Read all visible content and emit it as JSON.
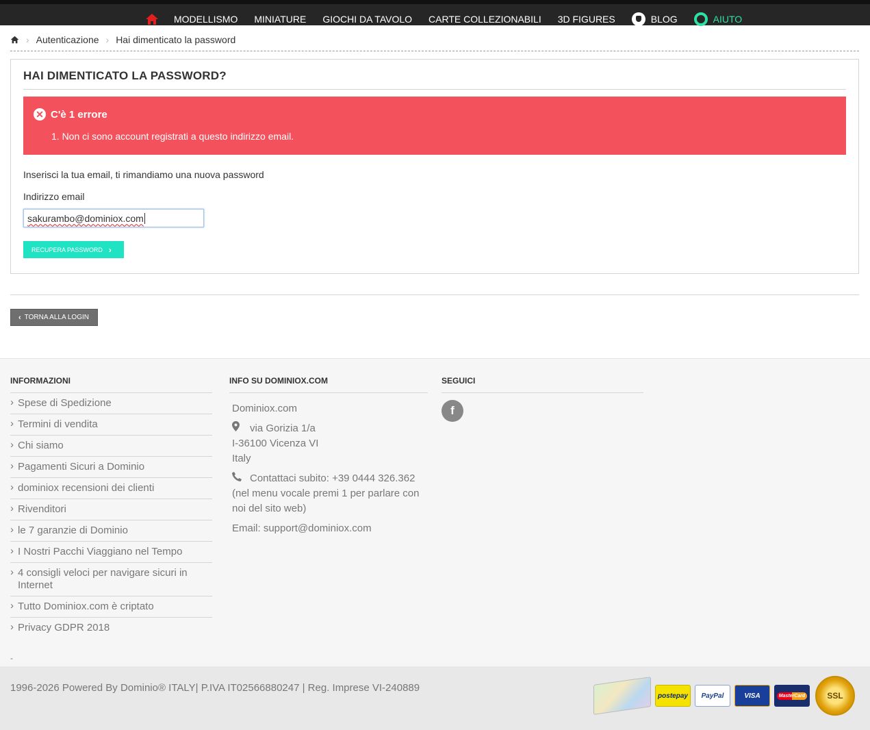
{
  "nav": {
    "home_icon": "home-icon",
    "items": [
      {
        "label": "MODELLISMO"
      },
      {
        "label": "MINIATURE"
      },
      {
        "label": "GIOCHI DA TAVOLO"
      },
      {
        "label": "CARTE COLLEZIONABILI"
      },
      {
        "label": "3D FIGURES"
      }
    ],
    "blog_label": "BLOG",
    "help_label": "AIUTO",
    "accent_color": "#2fe0a5",
    "home_color": "#e02020"
  },
  "breadcrumb": {
    "items": [
      "Autenticazione",
      "Hai dimenticato la password"
    ]
  },
  "page": {
    "title": "HAI DIMENTICATO LA PASSWORD?",
    "alert": {
      "title": "C'è 1 errore",
      "items": [
        "1. Non ci sono account registrati a questo indirizzo email."
      ],
      "color": "#f3515c"
    },
    "intro": "Inserisci la tua email, ti rimandiamo una nuova password",
    "email_label": "Indirizzo email",
    "email_value": "sakurambo@dominiox.com",
    "submit_label": "RECUPERA PASSWORD",
    "submit_color": "#20e3c4",
    "back_label": "TORNA ALLA LOGIN"
  },
  "footer": {
    "col1": {
      "title": "INFORMAZIONI",
      "links": [
        "Spese di Spedizione",
        "Termini di vendita",
        "Chi siamo",
        "Pagamenti Sicuri a Dominio",
        "dominiox recensioni dei clienti",
        "Rivenditori",
        "le 7 garanzie di Dominio",
        "I Nostri Pacchi Viaggiano nel Tempo",
        "4 consigli veloci per navigare sicuri in Internet",
        "Tutto Dominiox.com è criptato",
        "Privacy GDPR 2018"
      ]
    },
    "col2": {
      "title": "INFO SU DOMINIOX.COM",
      "company": "Dominiox.com",
      "address_line1": "via Gorizia 1/a",
      "address_line2": "I-36100 Vicenza VI",
      "address_line3": "Italy",
      "phone_text": "Contattaci subito: +39 0444 326.362",
      "phone_note": "(nel menu vocale premi 1 per parlare con noi del sito web)",
      "email_text": "Email: support@dominiox.com"
    },
    "col3": {
      "title": "SEGUICI",
      "social": "facebook-icon"
    },
    "dash": "-",
    "copyright": "1996-2026 Powered By Dominio® ITALY| P.IVA IT02566880247 | Reg. Imprese VI-240889",
    "payments": [
      "postepay",
      "PayPal",
      "VISA",
      "MasterCard",
      "SSL"
    ]
  }
}
